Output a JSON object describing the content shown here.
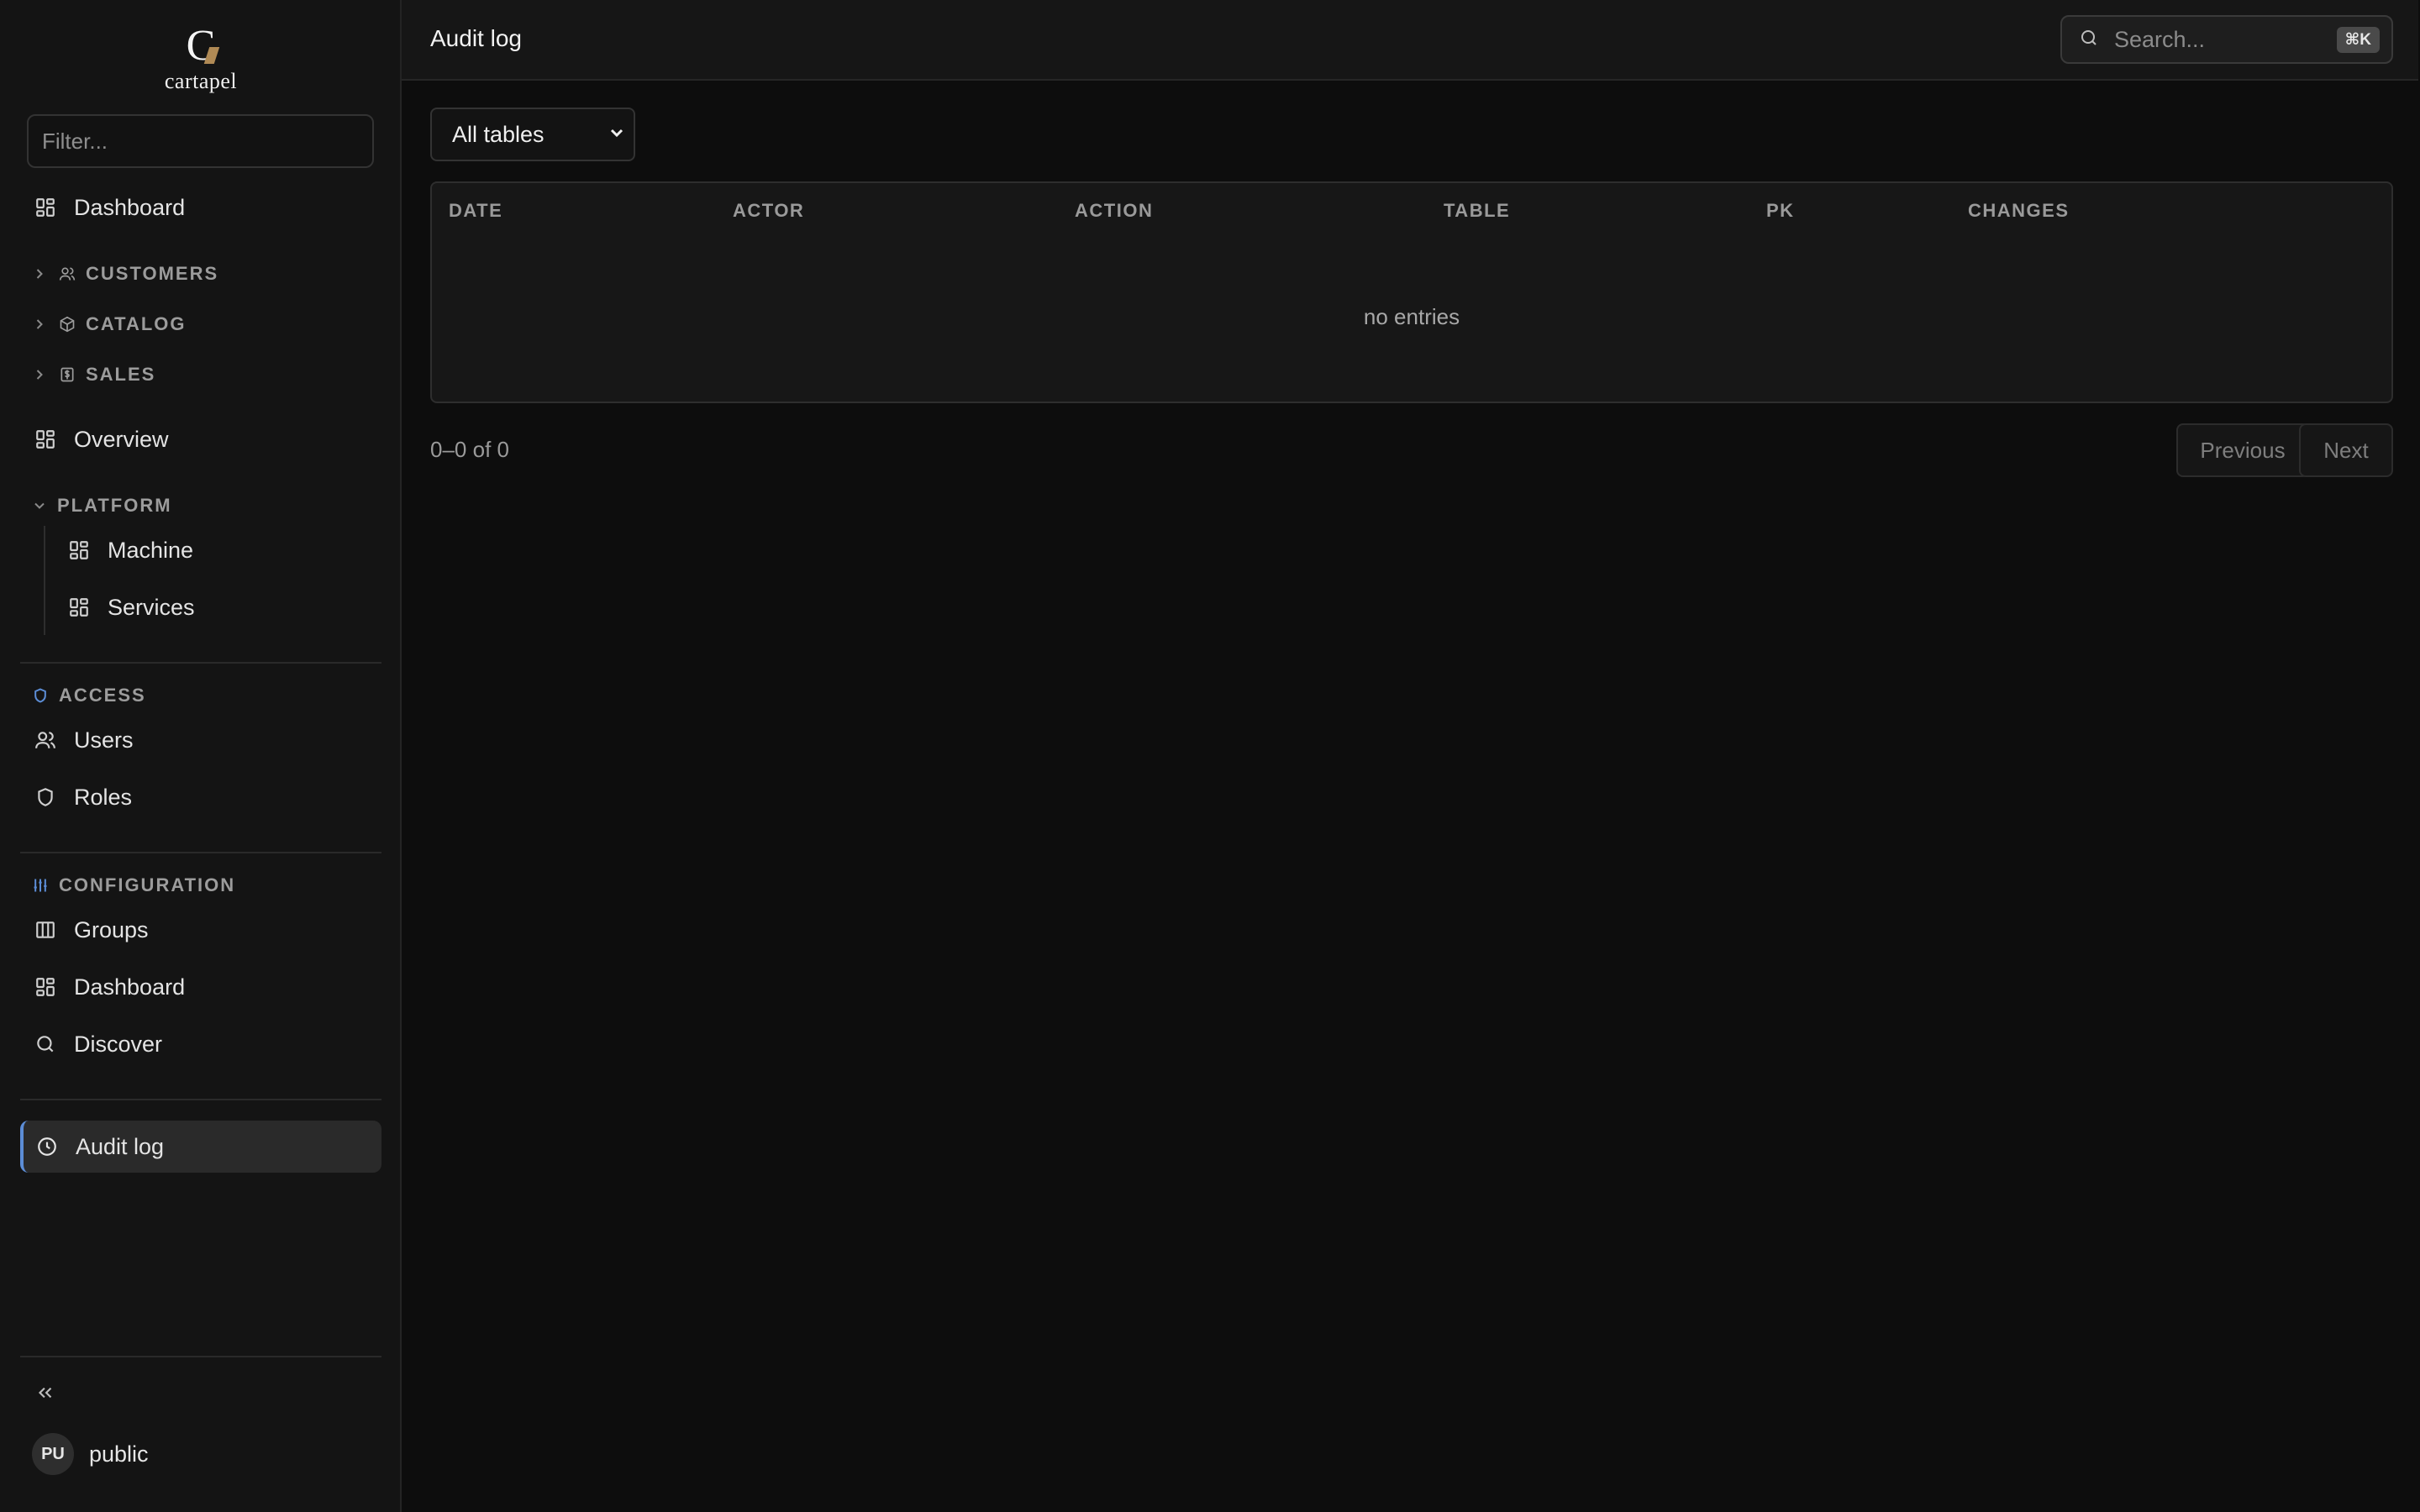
{
  "brand": {
    "mark": "C",
    "name": "cartapel"
  },
  "sidebar": {
    "filter_placeholder": "Filter...",
    "top_item": {
      "label": "Dashboard",
      "icon": "grid-icon"
    },
    "collapsed_sections": [
      {
        "label": "CUSTOMERS",
        "icon": "users-icon"
      },
      {
        "label": "CATALOG",
        "icon": "package-icon"
      },
      {
        "label": "SALES",
        "icon": "dollar-square-icon"
      }
    ],
    "overview": {
      "label": "Overview",
      "icon": "grid-icon"
    },
    "platform": {
      "label": "PLATFORM",
      "items": [
        {
          "label": "Machine",
          "icon": "grid-icon"
        },
        {
          "label": "Services",
          "icon": "grid-icon"
        }
      ]
    },
    "access": {
      "label": "ACCESS",
      "icon": "shield-icon",
      "items": [
        {
          "label": "Users",
          "icon": "users-icon"
        },
        {
          "label": "Roles",
          "icon": "shield-icon"
        }
      ]
    },
    "configuration": {
      "label": "CONFIGURATION",
      "icon": "sliders-icon",
      "items": [
        {
          "label": "Groups",
          "icon": "columns-icon"
        },
        {
          "label": "Dashboard",
          "icon": "grid-icon"
        },
        {
          "label": "Discover",
          "icon": "search-icon"
        }
      ]
    },
    "active_item": {
      "label": "Audit log",
      "icon": "clock-icon"
    },
    "user": {
      "initials": "PU",
      "name": "public"
    }
  },
  "header": {
    "title": "Audit log",
    "search_placeholder": "Search...",
    "search_shortcut": "⌘K"
  },
  "filter_select": {
    "value": "All tables"
  },
  "table": {
    "columns": [
      "DATE",
      "ACTOR",
      "ACTION",
      "TABLE",
      "PK",
      "CHANGES"
    ],
    "rows": [],
    "empty_text": "no entries"
  },
  "pagination": {
    "range_text": "0–0 of 0",
    "previous_label": "Previous",
    "next_label": "Next"
  },
  "colors": {
    "accent": "#5c8dd6",
    "brand_accent": "#b08a55",
    "background": "#0d0d0d",
    "sidebar_bg": "#141414"
  }
}
